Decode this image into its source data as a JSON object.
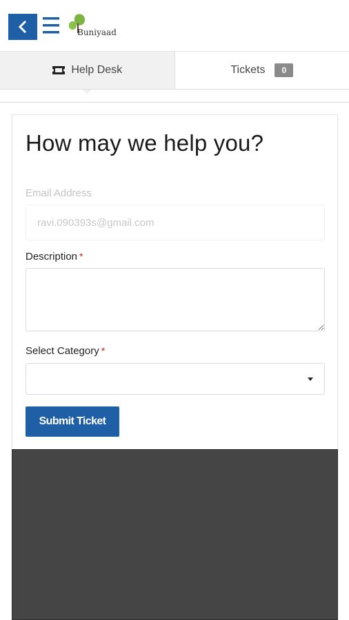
{
  "app": {
    "brand_name": "Buniyaad",
    "accent_color": "#1f5fa6"
  },
  "header": {
    "back_icon": "chevron-left-icon",
    "menu_icon": "hamburger-menu-icon"
  },
  "tabs": [
    {
      "label": "Help Desk",
      "icon": "ticket-icon",
      "active": true
    },
    {
      "label": "Tickets",
      "badge": "0",
      "active": false
    }
  ],
  "form": {
    "heading": "How may we help you?",
    "email": {
      "label": "Email Address",
      "value": "ravi.090393s@gmail.com"
    },
    "description": {
      "label": "Description",
      "required_mark": "*",
      "value": ""
    },
    "category": {
      "label": "Select Category",
      "required_mark": "*",
      "selected": ""
    },
    "submit_label": "Submit Ticket"
  }
}
